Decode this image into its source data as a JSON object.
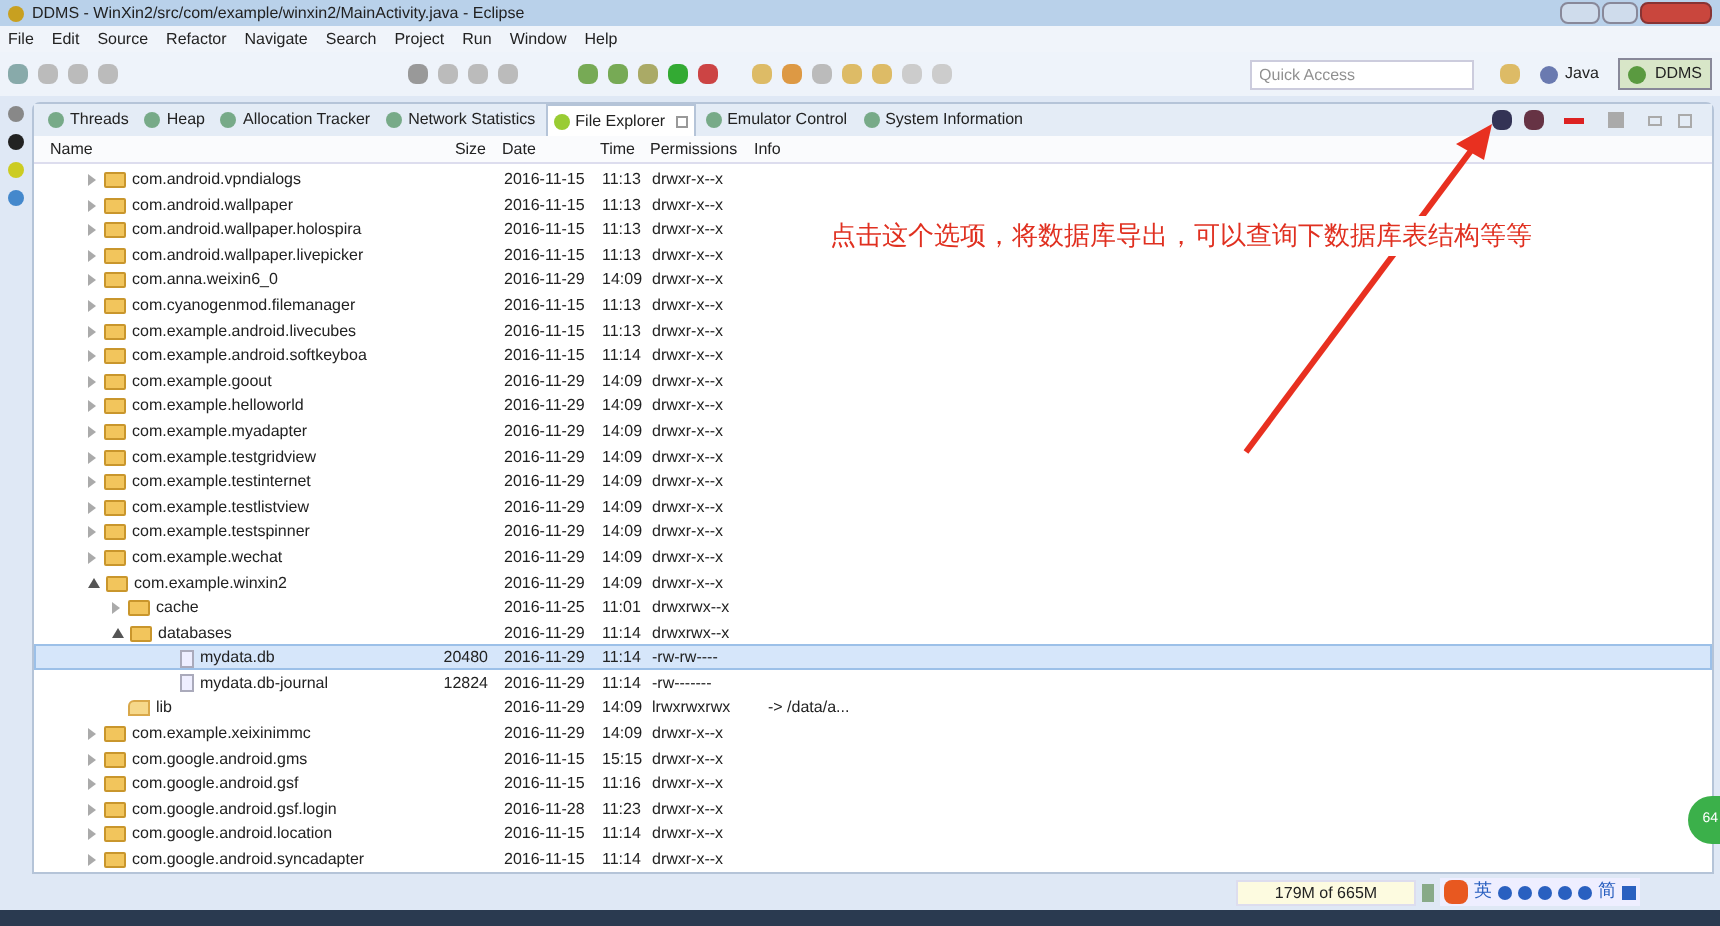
{
  "window": {
    "title": "DDMS - WinXin2/src/com/example/winxin2/MainActivity.java - Eclipse"
  },
  "menu": [
    "File",
    "Edit",
    "Source",
    "Refactor",
    "Navigate",
    "Search",
    "Project",
    "Run",
    "Window",
    "Help"
  ],
  "quick_access": {
    "placeholder": "Quick Access"
  },
  "perspectives": [
    {
      "label": "Java",
      "selected": false
    },
    {
      "label": "DDMS",
      "selected": true
    }
  ],
  "tabs": [
    {
      "label": "Threads",
      "selected": false
    },
    {
      "label": "Heap",
      "selected": false
    },
    {
      "label": "Allocation Tracker",
      "selected": false
    },
    {
      "label": "Network Statistics",
      "selected": false
    },
    {
      "label": "File Explorer",
      "selected": true
    },
    {
      "label": "Emulator Control",
      "selected": false
    },
    {
      "label": "System Information",
      "selected": false
    }
  ],
  "table": {
    "columns": [
      "Name",
      "Size",
      "Date",
      "Time",
      "Permissions",
      "Info"
    ],
    "rows": [
      {
        "kind": "folder",
        "name": "com.android.vpndialogs",
        "date": "2016-11-15",
        "time": "11:13",
        "permissions": "drwxr-x--x",
        "expanded": false,
        "selected": false
      },
      {
        "kind": "folder",
        "name": "com.android.wallpaper",
        "date": "2016-11-15",
        "time": "11:13",
        "permissions": "drwxr-x--x",
        "expanded": false,
        "selected": false
      },
      {
        "kind": "folder",
        "name": "com.android.wallpaper.holospira",
        "date": "2016-11-15",
        "time": "11:13",
        "permissions": "drwxr-x--x",
        "expanded": false,
        "selected": false
      },
      {
        "kind": "folder",
        "name": "com.android.wallpaper.livepicker",
        "date": "2016-11-15",
        "time": "11:13",
        "permissions": "drwxr-x--x",
        "expanded": false,
        "selected": false
      },
      {
        "kind": "folder",
        "name": "com.anna.weixin6_0",
        "date": "2016-11-29",
        "time": "14:09",
        "permissions": "drwxr-x--x",
        "expanded": false,
        "selected": false
      },
      {
        "kind": "folder",
        "name": "com.cyanogenmod.filemanager",
        "date": "2016-11-15",
        "time": "11:13",
        "permissions": "drwxr-x--x",
        "expanded": false,
        "selected": false
      },
      {
        "kind": "folder",
        "name": "com.example.android.livecubes",
        "date": "2016-11-15",
        "time": "11:13",
        "permissions": "drwxr-x--x",
        "expanded": false,
        "selected": false
      },
      {
        "kind": "folder",
        "name": "com.example.android.softkeyboa",
        "date": "2016-11-15",
        "time": "11:14",
        "permissions": "drwxr-x--x",
        "expanded": false,
        "selected": false
      },
      {
        "kind": "folder",
        "name": "com.example.goout",
        "date": "2016-11-29",
        "time": "14:09",
        "permissions": "drwxr-x--x",
        "expanded": false,
        "selected": false
      },
      {
        "kind": "folder",
        "name": "com.example.helloworld",
        "date": "2016-11-29",
        "time": "14:09",
        "permissions": "drwxr-x--x",
        "expanded": false,
        "selected": false
      },
      {
        "kind": "folder",
        "name": "com.example.myadapter",
        "date": "2016-11-29",
        "time": "14:09",
        "permissions": "drwxr-x--x",
        "expanded": false,
        "selected": false
      },
      {
        "kind": "folder",
        "name": "com.example.testgridview",
        "date": "2016-11-29",
        "time": "14:09",
        "permissions": "drwxr-x--x",
        "expanded": false,
        "selected": false
      },
      {
        "kind": "folder",
        "name": "com.example.testinternet",
        "date": "2016-11-29",
        "time": "14:09",
        "permissions": "drwxr-x--x",
        "expanded": false,
        "selected": false
      },
      {
        "kind": "folder",
        "name": "com.example.testlistview",
        "date": "2016-11-29",
        "time": "14:09",
        "permissions": "drwxr-x--x",
        "expanded": false,
        "selected": false
      },
      {
        "kind": "folder",
        "name": "com.example.testspinner",
        "date": "2016-11-29",
        "time": "14:09",
        "permissions": "drwxr-x--x",
        "expanded": false,
        "selected": false
      },
      {
        "kind": "folder",
        "name": "com.example.wechat",
        "date": "2016-11-29",
        "time": "14:09",
        "permissions": "drwxr-x--x",
        "expanded": false,
        "selected": false
      },
      {
        "kind": "folder",
        "name": "com.example.winxin2",
        "date": "2016-11-29",
        "time": "14:09",
        "permissions": "drwxr-x--x",
        "expanded": true,
        "selected": false,
        "children": [
          {
            "kind": "folder",
            "name": "cache",
            "date": "2016-11-25",
            "time": "11:01",
            "permissions": "drwxrwx--x",
            "expanded": false,
            "selected": false
          },
          {
            "kind": "folder",
            "name": "databases",
            "date": "2016-11-29",
            "time": "11:14",
            "permissions": "drwxrwx--x",
            "expanded": true,
            "selected": false,
            "children": [
              {
                "kind": "file",
                "name": "mydata.db",
                "size": "20480",
                "date": "2016-11-29",
                "time": "11:14",
                "permissions": "-rw-rw----",
                "selected": true
              },
              {
                "kind": "file",
                "name": "mydata.db-journal",
                "size": "12824",
                "date": "2016-11-29",
                "time": "11:14",
                "permissions": "-rw-------",
                "selected": false
              }
            ]
          },
          {
            "kind": "link",
            "name": "lib",
            "date": "2016-11-29",
            "time": "14:09",
            "permissions": "lrwxrwxrwx",
            "info": "-> /data/a...",
            "selected": false
          }
        ]
      },
      {
        "kind": "folder",
        "name": "com.example.xeixinimmc",
        "date": "2016-11-29",
        "time": "14:09",
        "permissions": "drwxr-x--x",
        "expanded": false,
        "selected": false
      },
      {
        "kind": "folder",
        "name": "com.google.android.gms",
        "date": "2016-11-15",
        "time": "15:15",
        "permissions": "drwxr-x--x",
        "expanded": false,
        "selected": false
      },
      {
        "kind": "folder",
        "name": "com.google.android.gsf",
        "date": "2016-11-15",
        "time": "11:16",
        "permissions": "drwxr-x--x",
        "expanded": false,
        "selected": false
      },
      {
        "kind": "folder",
        "name": "com.google.android.gsf.login",
        "date": "2016-11-28",
        "time": "11:23",
        "permissions": "drwxr-x--x",
        "expanded": false,
        "selected": false
      },
      {
        "kind": "folder",
        "name": "com.google.android.location",
        "date": "2016-11-15",
        "time": "11:14",
        "permissions": "drwxr-x--x",
        "expanded": false,
        "selected": false
      },
      {
        "kind": "folder",
        "name": "com.google.android.syncadapter",
        "date": "2016-11-15",
        "time": "11:14",
        "permissions": "drwxr-x--x",
        "expanded": false,
        "selected": false
      }
    ]
  },
  "annotation": "点击这个选项，将数据库导出，可以查询下数据库表结构等等",
  "status_bar": {
    "heap": "179M of 665M",
    "ime": [
      "英",
      "简"
    ]
  },
  "badge": "64"
}
